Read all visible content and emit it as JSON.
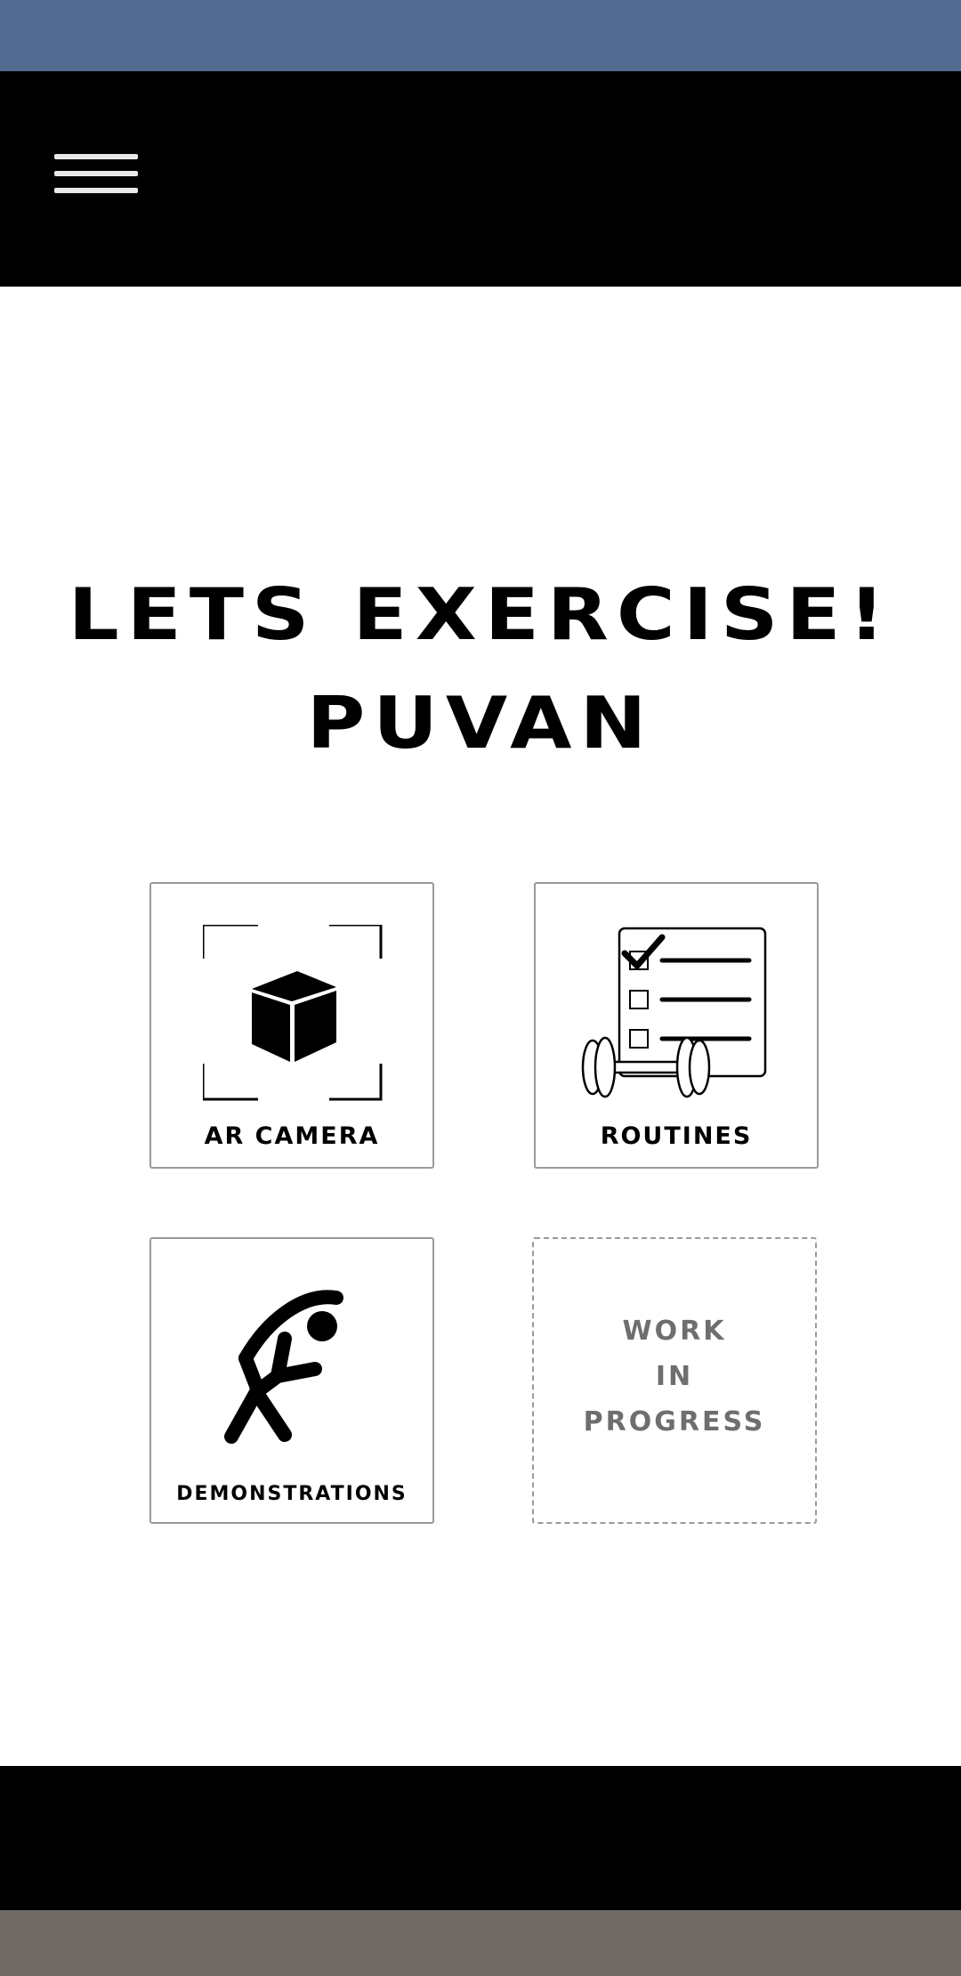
{
  "header": {
    "menu_icon": "hamburger-menu-icon"
  },
  "greeting": {
    "line1": "LETS EXERCISE!",
    "line2": "PUVAN"
  },
  "tiles": [
    {
      "label": "AR CAMERA",
      "icon": "ar-cube-icon"
    },
    {
      "label": "ROUTINES",
      "icon": "checklist-dumbbell-icon"
    },
    {
      "label": "DEMONSTRATIONS",
      "icon": "stretching-person-icon"
    },
    {
      "label_lines": [
        "WORK",
        "IN",
        "PROGRESS"
      ]
    }
  ],
  "colors": {
    "status_bar": "#526b91",
    "app_bar": "#000000",
    "nav_bar": "#6f6a66",
    "wip_text": "#6e6e6e"
  }
}
